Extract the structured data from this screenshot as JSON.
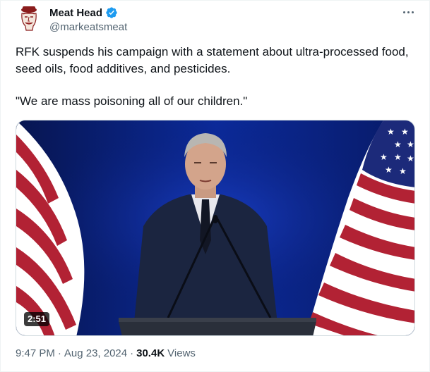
{
  "author": {
    "display_name": "Meat Head",
    "handle": "@markeatsmeat",
    "verified_color": "#1d9bf0"
  },
  "tweet": {
    "text_line1": "RFK suspends his campaign with a statement about ultra-processed food, seed oils, food additives, and pesticides.",
    "text_line2": "\"We are mass poisoning all of our children.\""
  },
  "media": {
    "type": "video",
    "duration": "2:51"
  },
  "meta": {
    "time": "9:47 PM",
    "separator": "·",
    "date": "Aug 23, 2024",
    "views_count": "30.4K",
    "views_label": "Views"
  },
  "icons": [
    "avatar-logo",
    "verified-badge-icon",
    "more-options-icon"
  ]
}
